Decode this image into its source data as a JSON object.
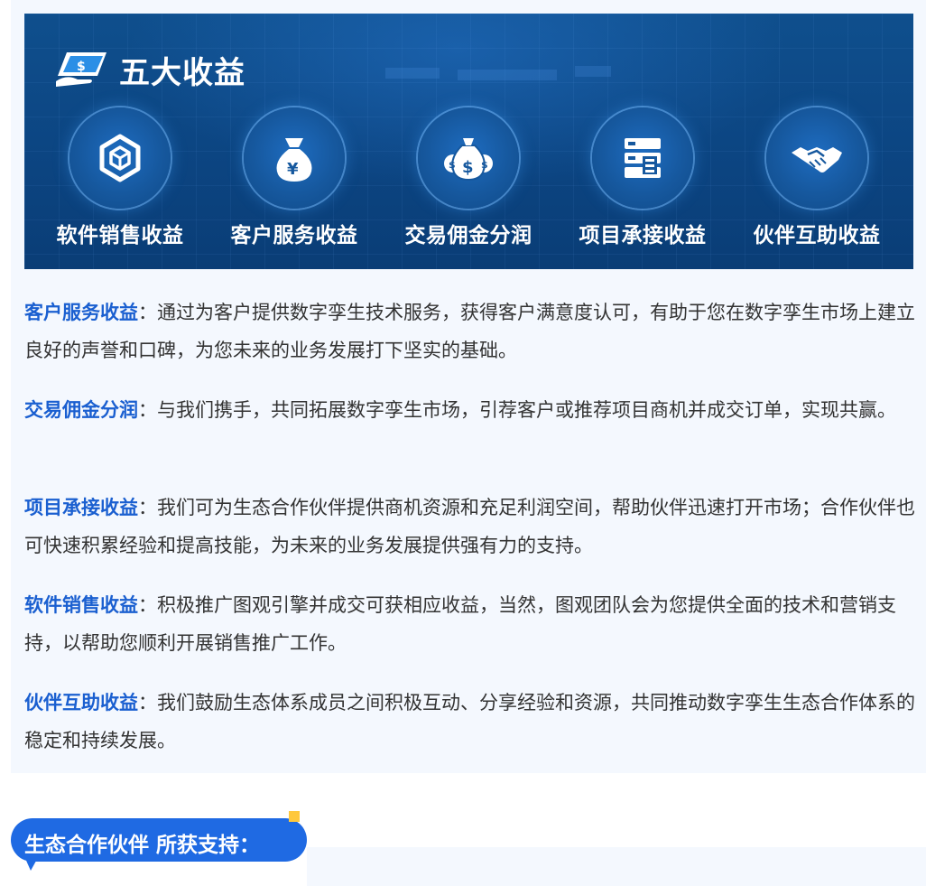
{
  "banner": {
    "title": "五大收益",
    "icon": "dollar-card-icon",
    "colors": {
      "bg": "#0c4582",
      "accent": "#1a5fd0"
    },
    "items": [
      {
        "label": "软件销售收益",
        "icon": "cube-icon"
      },
      {
        "label": "客户服务收益",
        "icon": "money-bag-icon"
      },
      {
        "label": "交易佣金分润",
        "icon": "money-bags-icon"
      },
      {
        "label": "项目承接收益",
        "icon": "server-document-icon"
      },
      {
        "label": "伙伴互助收益",
        "icon": "handshake-icon"
      }
    ]
  },
  "descriptions": [
    {
      "term": "客户服务收益",
      "sep": "：",
      "text": "通过为客户提供数字孪生技术服务，获得客户满意度认可，有助于您在数字孪生市场上建立良好的声誉和口碑，为您未来的业务发展打下坚实的基础。"
    },
    {
      "term": "交易佣金分润",
      "sep": "：",
      "text": "与我们携手，共同拓展数字孪生市场，引荐客户或推荐项目商机并成交订单，实现共赢。"
    },
    {
      "term": "项目承接收益",
      "sep": "：",
      "text": "我们可为生态合作伙伴提供商机资源和充足利润空间，帮助伙伴迅速打开市场；合作伙伴也可快速积累经验和提高技能，为未来的业务发展提供强有力的支持。"
    },
    {
      "term": "软件销售收益",
      "sep": "：",
      "text": "积极推广图观引擎并成交可获相应收益，当然，图观团队会为您提供全面的技术和营销支持，以帮助您顺利开展销售推广工作。"
    },
    {
      "term": "伙伴互助收益",
      "sep": "：",
      "text": "我们鼓励生态体系成员之间积极互动、分享经验和资源，共同推动数字孪生生态合作体系的稳定和持续发展。"
    }
  ],
  "section": {
    "title": "生态合作伙伴 所获支持：",
    "color": "#1f6ae3",
    "dot_color": "#ffc83d"
  }
}
